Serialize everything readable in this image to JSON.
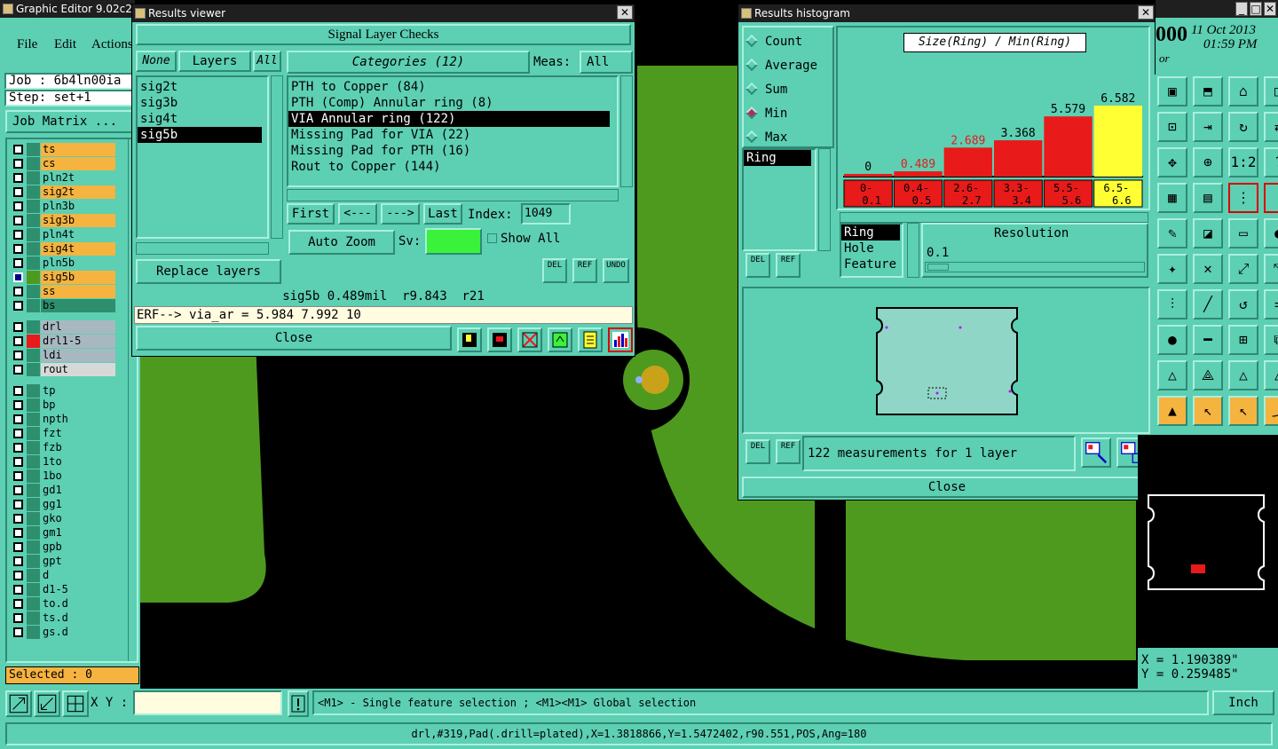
{
  "main_window": {
    "title": "Graphic Editor 9.02c2",
    "menu": [
      "File",
      "Edit",
      "Actions"
    ],
    "job_label": "Job : 6b4ln00ia",
    "step_label": "Step: set+1",
    "job_matrix_button": "Job Matrix ...",
    "date": "11 Oct 2013",
    "time": "01:59 PM",
    "partial_digits": "000",
    "partial_text": "or",
    "layers": [
      {
        "name": "ts",
        "color": "#f5b340"
      },
      {
        "name": "cs",
        "color": "#f5b340"
      },
      {
        "name": "pln2t",
        "color": "#5dcfb3"
      },
      {
        "name": "sig2t",
        "color": "#f5b340"
      },
      {
        "name": "pln3b",
        "color": "#5dcfb3"
      },
      {
        "name": "sig3b",
        "color": "#f5b340"
      },
      {
        "name": "pln4t",
        "color": "#5dcfb3"
      },
      {
        "name": "sig4t",
        "color": "#f5b340"
      },
      {
        "name": "pln5b",
        "color": "#5dcfb3"
      },
      {
        "name": "sig5b",
        "color": "#f5b340"
      },
      {
        "name": "ss",
        "color": "#f5b340"
      },
      {
        "name": "bs",
        "color": "#2e8f6e"
      },
      {
        "name": "drl",
        "color": "#a8b8c0"
      },
      {
        "name": "drl1-5",
        "color": "#a8b8c0"
      },
      {
        "name": "ldi",
        "color": "#a8b8c0"
      },
      {
        "name": "rout",
        "color": "#d8d8d8"
      },
      {
        "name": "tp",
        "color": "#5dcfb3"
      },
      {
        "name": "bp",
        "color": "#5dcfb3"
      },
      {
        "name": "npth",
        "color": "#5dcfb3"
      },
      {
        "name": "fzt",
        "color": "#5dcfb3"
      },
      {
        "name": "fzb",
        "color": "#5dcfb3"
      },
      {
        "name": "1to",
        "color": "#5dcfb3"
      },
      {
        "name": "1bo",
        "color": "#5dcfb3"
      },
      {
        "name": "gd1",
        "color": "#5dcfb3"
      },
      {
        "name": "gg1",
        "color": "#5dcfb3"
      },
      {
        "name": "gko",
        "color": "#5dcfb3"
      },
      {
        "name": "gm1",
        "color": "#5dcfb3"
      },
      {
        "name": "gpb",
        "color": "#5dcfb3"
      },
      {
        "name": "gpt",
        "color": "#5dcfb3"
      },
      {
        "name": "d",
        "color": "#5dcfb3"
      },
      {
        "name": "d1-5",
        "color": "#5dcfb3"
      },
      {
        "name": "to.d",
        "color": "#5dcfb3"
      },
      {
        "name": "ts.d",
        "color": "#5dcfb3"
      },
      {
        "name": "gs.d",
        "color": "#5dcfb3"
      }
    ],
    "selected_label": "Selected : 0",
    "xy_label": "X Y :",
    "xy_value": "",
    "hint": "<M1> - Single feature selection ; <M1><M1> Global selection",
    "units": "Inch",
    "status_line": "drl,#319,Pad(.drill=plated),X=1.3818866,Y=1.5472402,r90.551,POS,Ang=180",
    "coord_x": "X = 1.190389\"",
    "coord_y": "Y = 0.259485\""
  },
  "results_viewer": {
    "title": "Results viewer",
    "heading": "Signal Layer Checks",
    "layer_tabs": [
      "None",
      "Layers",
      "All"
    ],
    "layers": [
      "sig2t",
      "sig3b",
      "sig4t",
      "sig5b"
    ],
    "selected_layer": "sig5b",
    "categories_label": "Categories (12)",
    "meas_label": "Meas:",
    "meas_value": "All",
    "categories": [
      "PTH to Copper (84)",
      "PTH (Comp) Annular ring (8)",
      "VIA Annular ring (122)",
      "Missing Pad for VIA (22)",
      "Missing Pad for PTH (16)",
      "Rout to Copper (144)"
    ],
    "selected_category": "VIA Annular ring (122)",
    "nav": {
      "first": "First",
      "prev": "<---",
      "next": "--->",
      "last": "Last",
      "index_label": "Index:",
      "index_value": "1049"
    },
    "auto_zoom": "Auto Zoom",
    "sv_label": "Sv:",
    "show_all": "Show All",
    "replace_layers": "Replace layers",
    "small_buttons": [
      "DEL",
      "REF",
      "UNDO"
    ],
    "info_line": "sig5b 0.489mil  r9.843  r21",
    "erf_line": "ERF--> via_ar = 5.984 7.992 10",
    "close": "Close"
  },
  "histogram": {
    "title": "Results histogram",
    "modes": [
      "Count",
      "Average",
      "Sum",
      "Min",
      "Max"
    ],
    "selected_mode": "Min",
    "chart_title": "Size(Ring) / Min(Ring)",
    "measure_list": [
      "Ring"
    ],
    "measure_list2": [
      "Ring",
      "Hole",
      "Feature"
    ],
    "resolution_label": "Resolution",
    "resolution_value": "0.1",
    "summary": "122 measurements for 1 layer",
    "small_buttons": [
      "DEL",
      "REF"
    ],
    "close": "Close"
  },
  "chart_data": {
    "type": "bar",
    "title": "Size(Ring) / Min(Ring)",
    "categories": [
      "0-\n0.1",
      "0.4-\n0.5",
      "2.6-\n2.7",
      "3.3-\n3.4",
      "5.5-\n5.6",
      "6.5-\n6.6"
    ],
    "category_labels_top": [
      "0-",
      "0.4-",
      "2.6-",
      "3.3-",
      "5.5-",
      "6.5-"
    ],
    "category_labels_bottom": [
      "0.1",
      "0.5",
      "2.7",
      "3.4",
      "5.6",
      "6.6"
    ],
    "values": [
      0,
      0.489,
      2.689,
      3.368,
      5.579,
      6.582
    ],
    "value_labels": [
      "0",
      "0.489",
      "2.689",
      "3.368",
      "5.579",
      "6.582"
    ],
    "bar_colors": [
      "#e81a1a",
      "#e81a1a",
      "#e81a1a",
      "#e81a1a",
      "#e81a1a",
      "#ffff33"
    ],
    "label_colors": [
      "#000000",
      "#e81a1a",
      "#e81a1a",
      "#000000",
      "#000000",
      "#000000"
    ],
    "ylim": [
      0,
      6.582
    ]
  }
}
